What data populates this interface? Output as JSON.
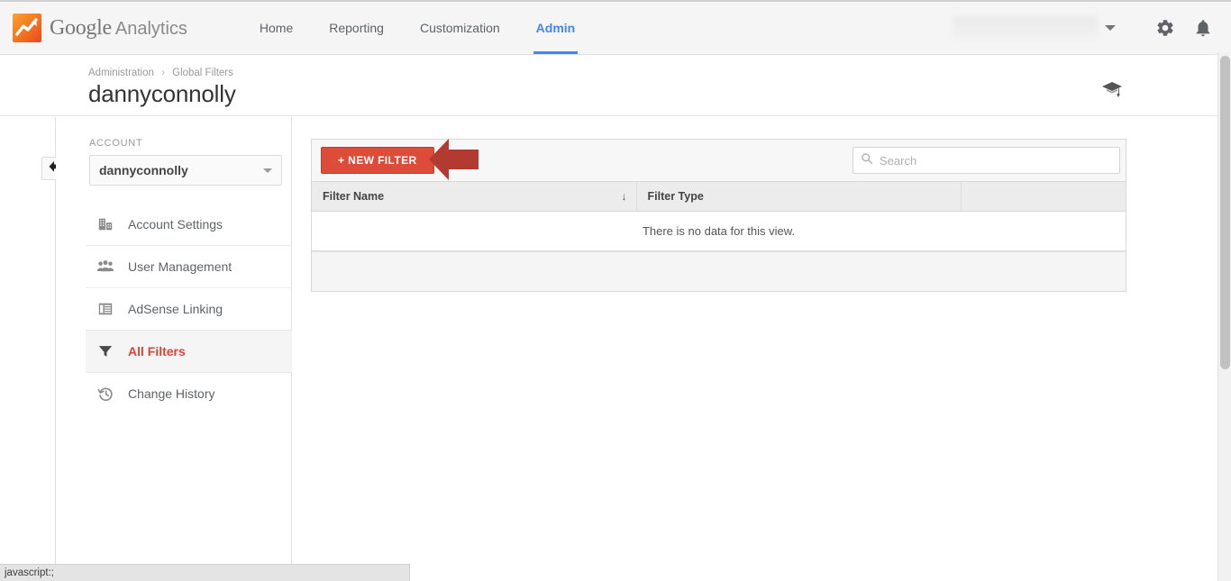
{
  "app": {
    "brand_primary": "Google",
    "brand_secondary": "Analytics",
    "logo_icon": "analytics-logo-icon",
    "accent_blue": "#4285F4",
    "accent_red": "#DD4B39",
    "annotation_red": "#B23A30"
  },
  "topnav": {
    "tabs": [
      {
        "label": "Home",
        "active": false
      },
      {
        "label": "Reporting",
        "active": false
      },
      {
        "label": "Customization",
        "active": false
      },
      {
        "label": "Admin",
        "active": true
      }
    ],
    "account_menu_caret": "caret-down-icon",
    "settings_icon": "gear-icon",
    "notifications_icon": "bell-icon"
  },
  "header": {
    "breadcrumb": {
      "parent": "Administration",
      "separator": "›",
      "current": "Global Filters"
    },
    "title": "dannyconnolly",
    "help_icon": "graduation-cap-icon"
  },
  "rail": {
    "collapse_icon": "arrow-left-icon"
  },
  "sidebar": {
    "section_label": "ACCOUNT",
    "account_select": {
      "value": "dannyconnolly",
      "caret": "caret-down-icon"
    },
    "items": [
      {
        "label": "Account Settings",
        "icon": "building-icon",
        "active": false
      },
      {
        "label": "User Management",
        "icon": "people-icon",
        "active": false
      },
      {
        "label": "AdSense Linking",
        "icon": "list-panel-icon",
        "active": false
      },
      {
        "label": "All Filters",
        "icon": "funnel-icon",
        "active": true
      },
      {
        "label": "Change History",
        "icon": "clock-revert-icon",
        "active": false
      }
    ]
  },
  "main": {
    "toolbar": {
      "new_filter_label": "+ NEW FILTER",
      "search": {
        "placeholder": "Search",
        "value": "",
        "icon": "search-icon"
      }
    },
    "table": {
      "columns": [
        {
          "label": "Filter Name",
          "sort_indicator": "↓"
        },
        {
          "label": "Filter Type",
          "sort_indicator": ""
        },
        {
          "label": "",
          "sort_indicator": ""
        }
      ],
      "rows": [],
      "empty_message": "There is no data for this view."
    },
    "annotation": {
      "shape": "arrow-left-annotation",
      "points_to": "+ NEW FILTER"
    }
  },
  "statusbar": {
    "text": "javascript:;"
  }
}
